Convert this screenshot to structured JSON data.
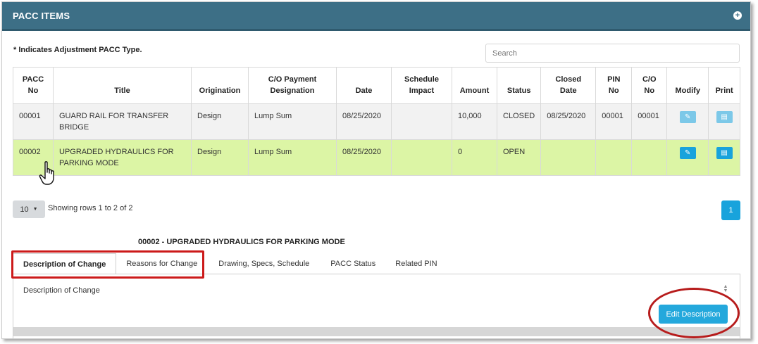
{
  "header": {
    "title": "PACC ITEMS",
    "expand_icon": "plus-circle-icon"
  },
  "note": "* Indicates Adjustment PACC Type.",
  "search": {
    "placeholder": "Search",
    "value": ""
  },
  "table": {
    "columns": [
      "PACC No",
      "Title",
      "Origination",
      "C/O Payment Designation",
      "Date",
      "Schedule Impact",
      "Amount",
      "Status",
      "Closed Date",
      "PIN No",
      "C/O No",
      "Modify",
      "Print"
    ],
    "rows": [
      {
        "pacc_no": "00001",
        "title": "GUARD RAIL FOR TRANSFER BRIDGE",
        "origination": "Design",
        "co_payment": "Lump Sum",
        "date": "08/25/2020",
        "schedule_impact": "",
        "amount": "10,000",
        "status": "CLOSED",
        "closed_date": "08/25/2020",
        "pin_no": "00001",
        "co_no": "00001"
      },
      {
        "pacc_no": "00002",
        "title": "UPGRADED HYDRAULICS FOR PARKING MODE",
        "origination": "Design",
        "co_payment": "Lump Sum",
        "date": "08/25/2020",
        "schedule_impact": "",
        "amount": "0",
        "status": "OPEN",
        "closed_date": "",
        "pin_no": "",
        "co_no": ""
      }
    ]
  },
  "pagination": {
    "page_size": "10",
    "showing": "Showing rows 1 to 2 of 2",
    "current_page": "1"
  },
  "detail": {
    "title": "00002 - UPGRADED HYDRAULICS FOR PARKING MODE",
    "tabs": [
      "Description of Change",
      "Reasons for Change",
      "Drawing, Specs, Schedule",
      "PACC Status",
      "Related PIN"
    ],
    "active_tab": "Description of Change",
    "panel_label": "Description of Change",
    "edit_button": "Edit Description"
  },
  "colors": {
    "header": "#3d6f86",
    "accent": "#18a3dc",
    "selected_row": "#dcf5a5",
    "highlight_red": "#cc1a1a"
  }
}
